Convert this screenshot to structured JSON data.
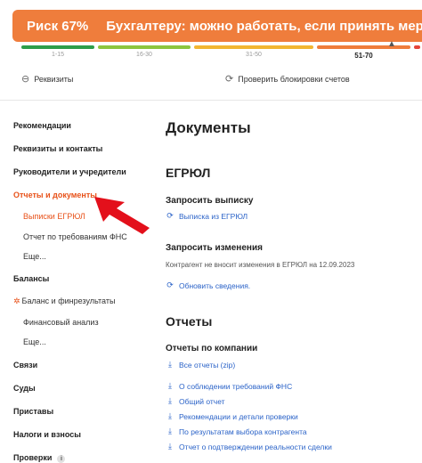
{
  "risk": {
    "percent": "Риск 67%",
    "message": "Бухгалтеру: можно работать, если принять меры безопа"
  },
  "scale": {
    "segments": [
      {
        "label": "1-15",
        "color": "#2e9e4a"
      },
      {
        "label": "16-30",
        "color": "#8cc63f"
      },
      {
        "label": "31-50",
        "color": "#f2b632"
      },
      {
        "label": "51-70",
        "color": "#ef7d3c"
      },
      {
        "label": "",
        "color": "#e5453a"
      }
    ],
    "active_index": 3,
    "marker_icon": "triangle-up-icon"
  },
  "toolbar": {
    "requisites": "Реквизиты",
    "check_blocks": "Проверить блокировки счетов"
  },
  "sidebar": {
    "recommendations": "Рекомендации",
    "requisites_contacts": "Реквизиты и контакты",
    "managers_founders": "Руководители и учредители",
    "reports_documents": "Отчеты и документы",
    "egrul_extracts": "Выписки ЕГРЮЛ",
    "fns_report": "Отчет по требованиям ФНС",
    "more1": "Еще...",
    "balances": "Балансы",
    "balance_fin": "Баланс и финрезультаты",
    "fin_analysis": "Финансовый анализ",
    "more2": "Еще...",
    "connections": "Связи",
    "courts": "Суды",
    "bailiffs": "Приставы",
    "taxes": "Налоги и взносы",
    "inspections": "Проверки"
  },
  "main": {
    "title": "Документы",
    "egrul": "ЕГРЮЛ",
    "request_extract": "Запросить выписку",
    "extract_link": "Выписка из ЕГРЮЛ",
    "request_changes": "Запросить изменения",
    "changes_note": "Контрагент не вносит изменения в ЕГРЮЛ на 12.09.2023",
    "update_link": "Обновить сведения.",
    "reports": "Отчеты",
    "company_reports": "Отчеты по компании",
    "links": [
      "Все отчеты (zip)",
      "О соблюдении требований ФНС",
      "Общий отчет",
      "Рекомендации и детали проверки",
      "По результатам выбора контрагента",
      "Отчет о подтверждении реальности сделки"
    ]
  },
  "colors": {
    "accent": "#ef7d3c",
    "active_link": "#e8521a",
    "link": "#2b63c8",
    "arrow": "#e3101b"
  }
}
